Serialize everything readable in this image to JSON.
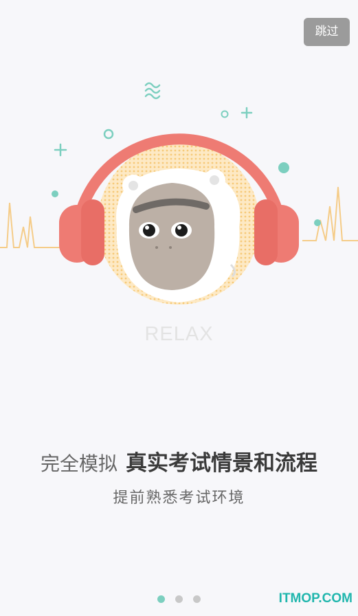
{
  "header": {
    "skip_label": "跳过"
  },
  "illustration": {
    "caption": "RELAX",
    "icon": "headphone-animal-illustration"
  },
  "onboarding": {
    "headline_light": "完全模拟",
    "headline_bold": "真实考试情景和流程",
    "subline": "提前熟悉考试环境"
  },
  "pager": {
    "page_count": 3,
    "current_page": 1
  },
  "watermark": "ITMOP.COM",
  "colors": {
    "accent": "#7ccfbf",
    "headphone": "#ee7b73",
    "skip_bg": "#9b9b9b"
  }
}
